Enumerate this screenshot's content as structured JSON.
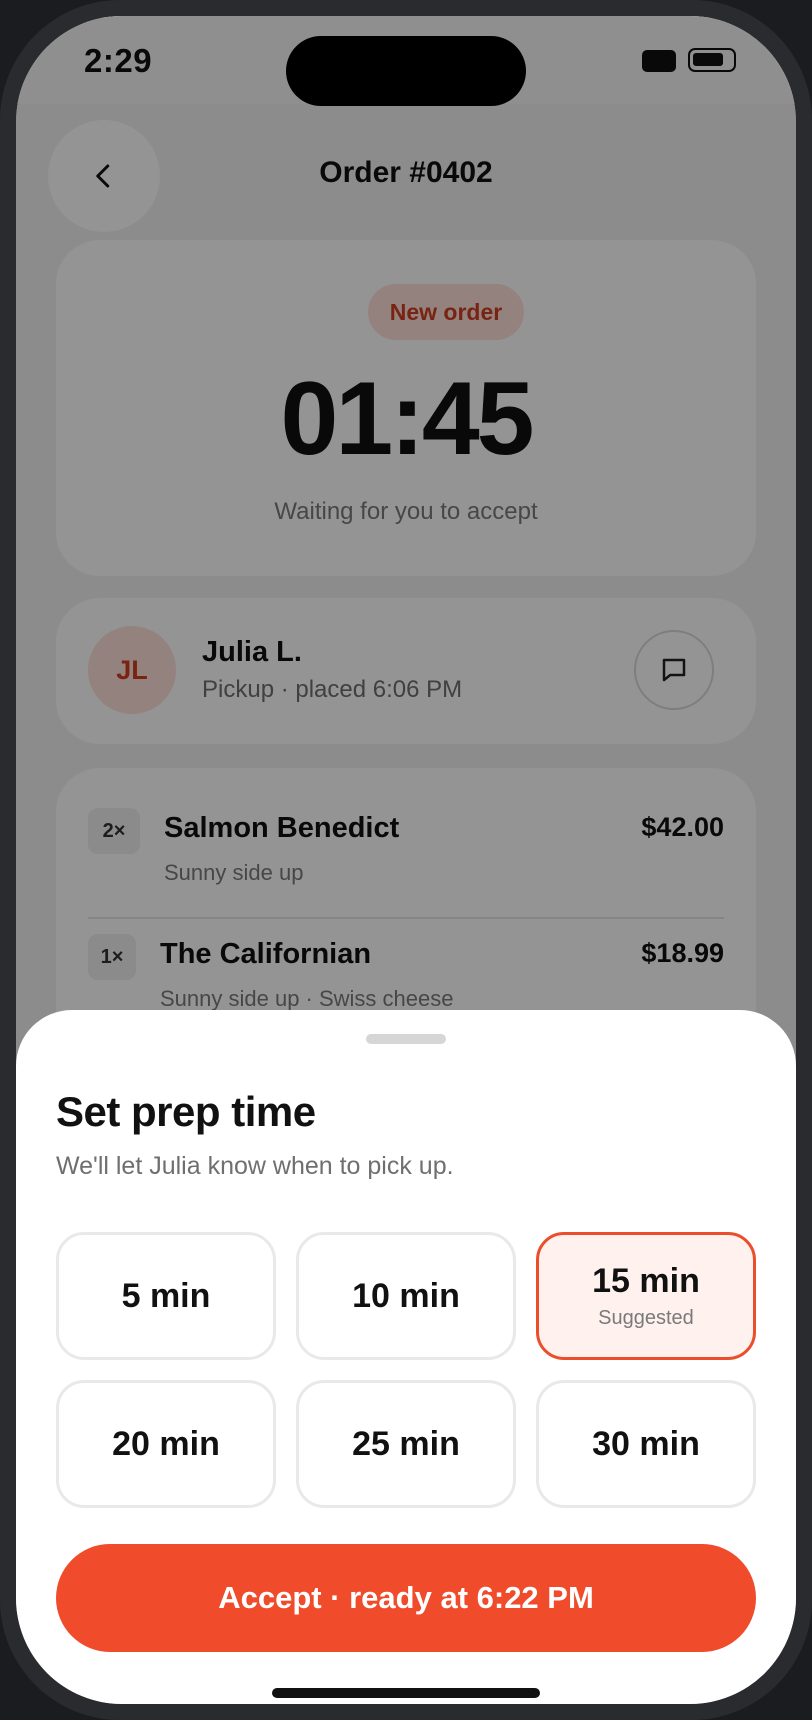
{
  "status_bar": {
    "time": "2:29"
  },
  "header": {
    "title": "Order #0402"
  },
  "timer": {
    "badge": "New order",
    "countdown": "01:45",
    "subtitle": "Waiting for you to accept"
  },
  "customer": {
    "initials": "JL",
    "name": "Julia L.",
    "details": "Pickup · placed 6:06 PM"
  },
  "items": [
    {
      "qty": "2×",
      "name": "Salmon Benedict",
      "modifiers": "Sunny side up",
      "price": "$42.00"
    },
    {
      "qty": "1×",
      "name": "The Californian",
      "modifiers": "Sunny side up · Swiss cheese",
      "price": "$18.99"
    }
  ],
  "prep_sheet": {
    "title": "Set prep time",
    "subtitle": "We'll let Julia know when to pick up.",
    "options": [
      {
        "label": "5 min"
      },
      {
        "label": "10 min"
      },
      {
        "label": "15 min",
        "hint": "Suggested",
        "selected": true
      },
      {
        "label": "20 min"
      },
      {
        "label": "25 min"
      },
      {
        "label": "30 min"
      }
    ],
    "accept_label": "Accept · ready at 6:22 PM"
  },
  "colors": {
    "accent": "#f04b2b",
    "badge_bg": "#fde1da",
    "badge_text": "#d13f22"
  },
  "icons": {
    "back": "chevron-left-icon",
    "chat": "chat-bubble-icon"
  }
}
